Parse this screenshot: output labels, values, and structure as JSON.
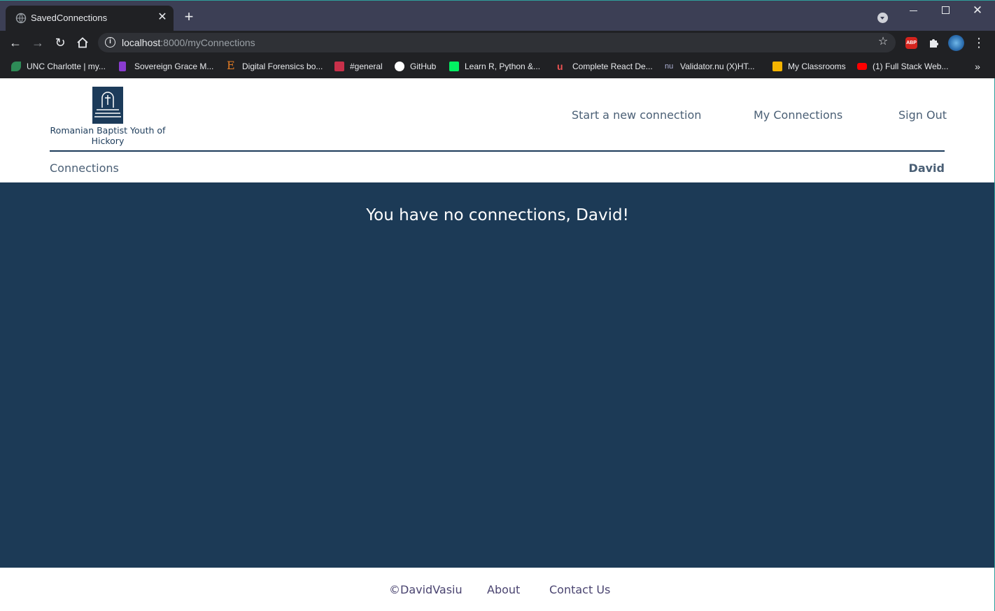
{
  "browser": {
    "tab_title": "SavedConnections",
    "url_host": "localhost",
    "url_rest": ":8000/myConnections",
    "icons": {
      "tab_favicon": "globe-icon",
      "tab_close": "close-icon",
      "new_tab": "plus-icon",
      "tab_search": "tab-search-icon",
      "back": "arrow-left-icon",
      "forward": "arrow-right-icon",
      "reload": "reload-icon",
      "home": "home-icon",
      "site_info": "info-icon",
      "bookmark_star": "star-icon",
      "extension_abp": "adblock-icon",
      "extensions": "puzzle-icon",
      "profile": "avatar",
      "menu": "more-vertical-icon"
    },
    "abp_label": "ABP",
    "bookmarks": [
      {
        "label": "UNC Charlotte | my...",
        "icon": "leaf-icon",
        "color": "#2e8b57"
      },
      {
        "label": "Sovereign Grace M...",
        "icon": "ribbon-icon",
        "color": "#8a3ccf"
      },
      {
        "label": "Digital Forensics bo...",
        "icon": "e-letter-icon",
        "color": "#e07b24"
      },
      {
        "label": "#general",
        "icon": "slack-icon",
        "color": "#c8304a"
      },
      {
        "label": "GitHub",
        "icon": "github-icon",
        "color": "#ffffff"
      },
      {
        "label": "Learn R, Python &...",
        "icon": "datacamp-icon",
        "color": "#03ef62"
      },
      {
        "label": "Complete React De...",
        "icon": "udemy-icon",
        "color": "#ec5252"
      },
      {
        "label": "Validator.nu (X)HT...",
        "icon": "nu-icon",
        "color": "#b0b4d8"
      },
      {
        "label": "My Classrooms",
        "icon": "box-icon",
        "color": "#f4b400"
      },
      {
        "label": "(1) Full Stack Web...",
        "icon": "youtube-icon",
        "color": "#ff0000"
      }
    ]
  },
  "site": {
    "logo_text": "Romanian Baptist Youth of Hickory",
    "nav": {
      "new_connection": "Start a new connection",
      "my_connections": "My Connections",
      "sign_out": "Sign Out"
    },
    "subheader": {
      "section": "Connections",
      "user": "David"
    },
    "main_message": "You have no connections, David!",
    "footer": {
      "copyright": "©DavidVasiu",
      "about": "About",
      "contact": "Contact Us"
    },
    "colors": {
      "brand": "#1c3b5a",
      "main_bg": "#1c3a56"
    }
  }
}
